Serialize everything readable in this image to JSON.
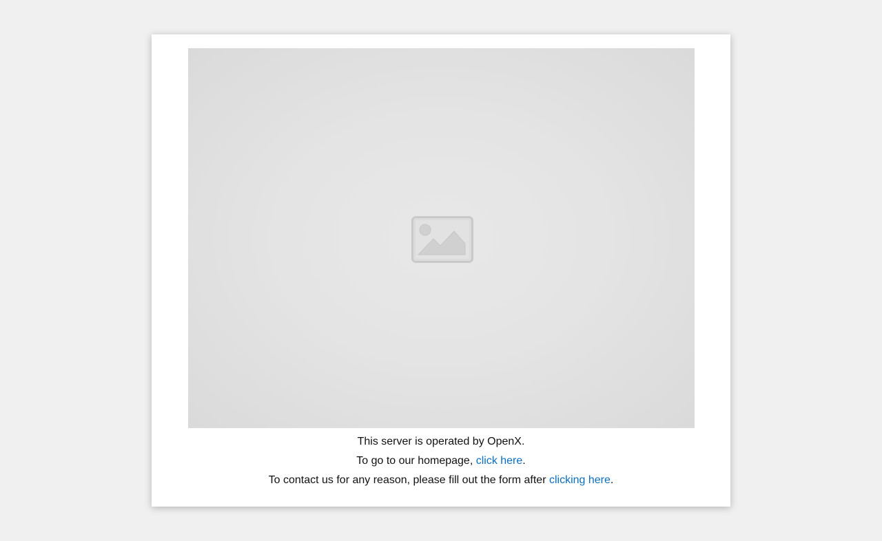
{
  "operator_line": "This server is operated by OpenX.",
  "homepage_line": {
    "prefix": "To go to our homepage, ",
    "link_label": "click here",
    "suffix": "."
  },
  "contact_line": {
    "prefix": "To contact us for any reason, please fill out the form after ",
    "link_label": "clicking here",
    "suffix": "."
  },
  "image_placeholder": {
    "icon": "broken-image-icon"
  },
  "colors": {
    "page_background": "#f0f0f0",
    "card_background": "#ffffff",
    "link": "#0a6fc2",
    "placeholder": "#e4e4e4"
  }
}
